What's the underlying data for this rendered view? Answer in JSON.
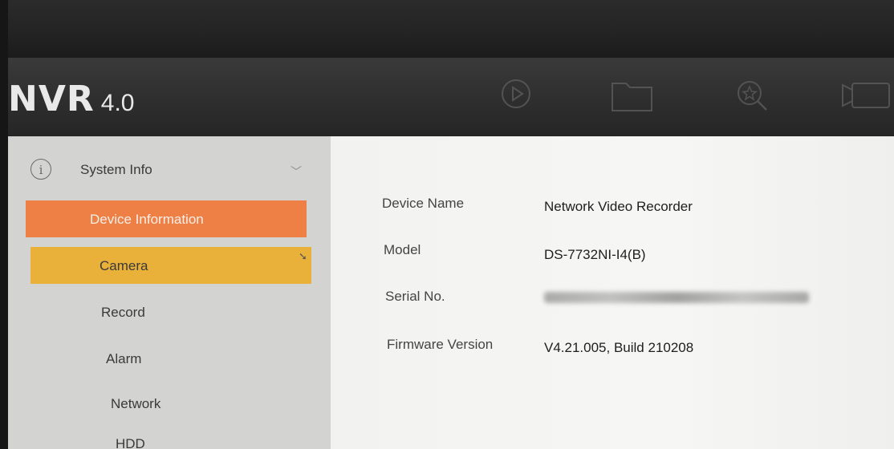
{
  "header": {
    "logo_main": "NVR",
    "logo_version": "4.0",
    "icons": [
      "playback-icon",
      "file-folder-icon",
      "search-icon",
      "camera-icon"
    ]
  },
  "sidebar": {
    "section": {
      "label": "System Info",
      "icon": "info-icon",
      "expanded": true
    },
    "items": [
      {
        "label": "Device Information",
        "active": true
      },
      {
        "label": "Camera",
        "hover": true
      },
      {
        "label": "Record"
      },
      {
        "label": "Alarm"
      },
      {
        "label": "Network"
      },
      {
        "label": "HDD"
      }
    ]
  },
  "device_info": {
    "rows": [
      {
        "label": "Device Name",
        "value": "Network Video Recorder"
      },
      {
        "label": "Model",
        "value": "DS-7732NI-I4(B)"
      },
      {
        "label": "Serial No.",
        "value": ""
      },
      {
        "label": "Firmware Version",
        "value": "V4.21.005, Build 210208"
      }
    ]
  },
  "colors": {
    "active_item": "#ee7f45",
    "hover_item": "#e9b13a",
    "sidebar_bg": "#d3d3d1",
    "content_bg": "#f4f4f2",
    "header_bg": "#2e2e2e"
  }
}
